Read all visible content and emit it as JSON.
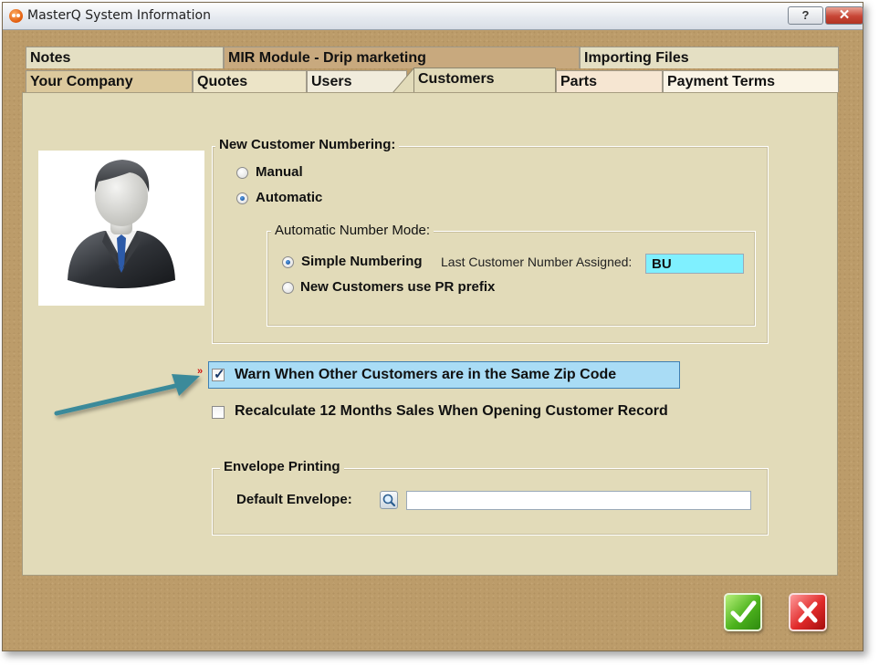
{
  "window": {
    "title": "MasterQ System Information"
  },
  "titlebar": {
    "help_label": "?",
    "close_label": "✕"
  },
  "tabs_row1": [
    {
      "label": "Notes"
    },
    {
      "label": "MIR Module - Drip marketing"
    },
    {
      "label": "Importing Files"
    }
  ],
  "tabs_row2": [
    {
      "label": "Your Company"
    },
    {
      "label": "Quotes"
    },
    {
      "label": "Users"
    },
    {
      "label": "Customers",
      "active": true
    },
    {
      "label": "Parts"
    },
    {
      "label": "Payment Terms"
    }
  ],
  "numbering": {
    "legend": "New Customer Numbering:",
    "manual_label": "Manual",
    "automatic_label": "Automatic",
    "selected": "Automatic",
    "mode": {
      "legend": "Automatic Number Mode:",
      "simple_label": "Simple Numbering",
      "last_assigned_label": "Last Customer Number Assigned:",
      "last_assigned_value": "BU",
      "pr_prefix_label": "New Customers use PR prefix",
      "selected": "Simple Numbering"
    }
  },
  "options": {
    "warn_zip_label": "Warn When Other Customers are in the Same Zip Code",
    "warn_zip_checked": true,
    "recalc_label": "Recalculate 12 Months Sales When Opening Customer Record",
    "recalc_checked": false,
    "marker": "»"
  },
  "envelope": {
    "legend": "Envelope Printing",
    "default_label": "Default Envelope:",
    "default_value": ""
  },
  "colors": {
    "frame": "#bc9c6a",
    "panel": "#e2dbb9",
    "highlight": "#a9dcf5",
    "cyan_field": "#7ff0ff",
    "arrow": "#3a8a9a"
  },
  "icons": [
    "app-icon",
    "user-avatar-icon",
    "magnifier-icon",
    "check-icon",
    "x-icon",
    "pointer-arrow-icon"
  ]
}
